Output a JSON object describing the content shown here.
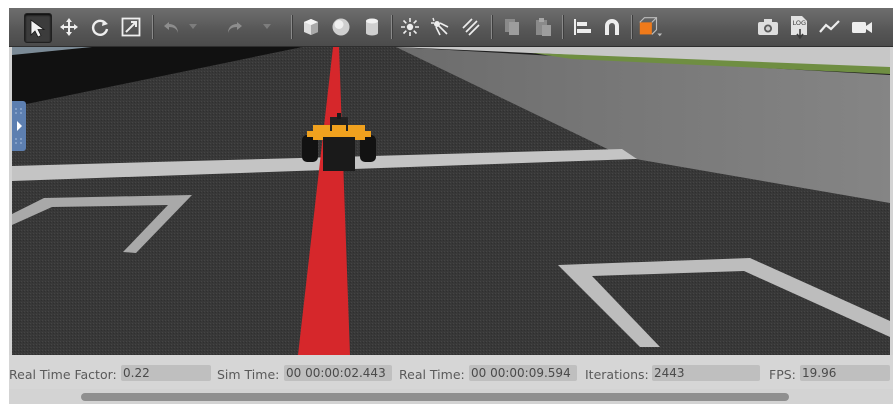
{
  "toolbar": {
    "tools": [
      {
        "id": "select-tool",
        "icon": "select-arrow-icon",
        "selected": true
      },
      {
        "id": "translate-tool",
        "icon": "move-arrows-icon"
      },
      {
        "id": "rotate-tool",
        "icon": "rotate-icon"
      },
      {
        "id": "scale-tool",
        "icon": "scale-icon"
      },
      {
        "id": "undo-button",
        "icon": "undo-icon"
      },
      {
        "id": "redo-button",
        "icon": "redo-icon"
      },
      {
        "id": "box-shape",
        "icon": "box-icon"
      },
      {
        "id": "sphere-shape",
        "icon": "sphere-icon"
      },
      {
        "id": "cylinder-shape",
        "icon": "cylinder-icon"
      },
      {
        "id": "point-light",
        "icon": "point-light-icon"
      },
      {
        "id": "spot-light",
        "icon": "spot-light-icon"
      },
      {
        "id": "directional-light",
        "icon": "directional-light-icon"
      },
      {
        "id": "copy-button",
        "icon": "copy-icon"
      },
      {
        "id": "paste-button",
        "icon": "paste-icon"
      },
      {
        "id": "align-tool",
        "icon": "align-icon"
      },
      {
        "id": "snap-tool",
        "icon": "magnet-icon"
      },
      {
        "id": "view-angle",
        "icon": "view-cube-icon"
      },
      {
        "id": "screenshot-button",
        "icon": "camera-icon"
      },
      {
        "id": "log-button",
        "icon": "log-icon",
        "text": "LOG"
      },
      {
        "id": "plot-button",
        "icon": "plot-icon"
      },
      {
        "id": "record-video-button",
        "icon": "video-icon"
      }
    ],
    "accent_color": "#f07a1a"
  },
  "status": {
    "real_time_factor_label": "Real Time Factor:",
    "real_time_factor": "0.22",
    "sim_time_label": "Sim Time:",
    "sim_time": "00 00:00:02.443",
    "real_time_label": "Real Time:",
    "real_time": "00 00:00:09.594",
    "iterations_label": "Iterations:",
    "iterations": "2443",
    "fps_label": "FPS:",
    "fps": "19.96"
  },
  "scene": {
    "ground_color": "#383838",
    "wall_color": "#7c7c7c",
    "line_color": "#d6272b",
    "marking_color": "#bdbdbd",
    "car_color": "#f0a11e"
  }
}
